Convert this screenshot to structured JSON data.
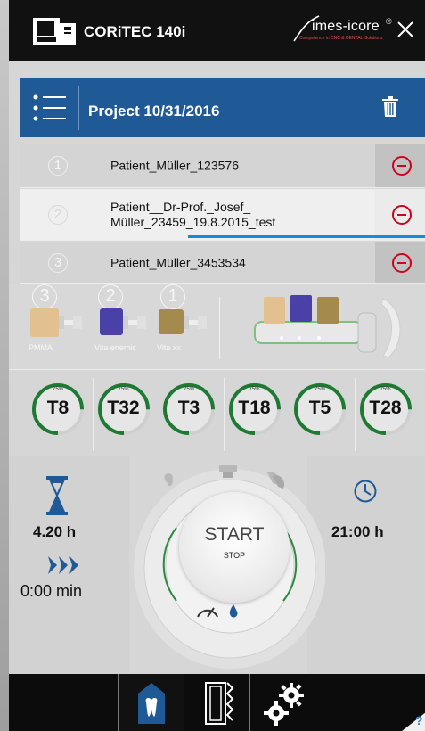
{
  "header": {
    "app_title": "CORiTEC 140i",
    "brand_name": "imes-icore",
    "brand_reg": "®",
    "brand_tagline": "Competence in CNC & DENTAL-Solutions",
    "machine_icon": "milling-machine-icon",
    "close_icon": "close-icon"
  },
  "project": {
    "title": "Project 10/31/2016",
    "list_icon": "list-icon",
    "trash_icon": "trash-icon"
  },
  "patients": [
    {
      "num": "1",
      "name": "Patient_Müller_123576"
    },
    {
      "num": "2",
      "name": "Patient__Dr-Prof._Josef_ Müller_23459_19.8.2015_test"
    },
    {
      "num": "3",
      "name": "Patient_Müller_3453534"
    }
  ],
  "blanks": [
    {
      "num": "3",
      "label": "PMMA",
      "color": "#e2c090"
    },
    {
      "num": "2",
      "label": "Vita enemic",
      "color": "#4b3fa8"
    },
    {
      "num": "1",
      "label": "Vita xx",
      "color": "#a48a4c"
    }
  ],
  "tools": [
    {
      "name": "T8",
      "pct": "75%",
      "level": 0.75
    },
    {
      "name": "T32",
      "pct": "75%",
      "level": 0.75
    },
    {
      "name": "T3",
      "pct": "75%",
      "level": 0.75
    },
    {
      "name": "T18",
      "pct": "75%",
      "level": 0.75
    },
    {
      "name": "T5",
      "pct": "75%",
      "level": 0.75
    },
    {
      "name": "T28",
      "pct": "75%",
      "level": 0.75
    }
  ],
  "timing": {
    "estimated": "4.20 h",
    "elapsed": "0:00 min",
    "end_time": "21:00 h"
  },
  "control": {
    "start_label": "START",
    "stop_label": "STOP"
  },
  "nav": {
    "tabs": [
      "tooth-home-icon",
      "blank-holder-icon",
      "settings-gears-icon"
    ],
    "help_label": "?"
  },
  "colors": {
    "header_blue": "#1f5a96",
    "remove_red": "#d0021b",
    "progress_green": "#1e7a32",
    "accent_blue": "#1a8ad6"
  }
}
